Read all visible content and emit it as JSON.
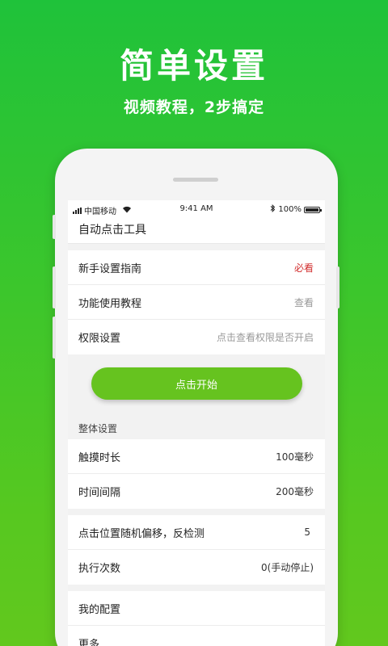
{
  "hero": {
    "title": "简单设置",
    "subtitle": "视频教程，2步搞定"
  },
  "status_bar": {
    "carrier": "中国移动",
    "time": "9:41 AM",
    "battery": "100%",
    "icons": [
      "signal-icon",
      "wifi-icon",
      "bluetooth-icon",
      "battery-icon"
    ]
  },
  "app": {
    "title": "自动点击工具"
  },
  "guide_group": [
    {
      "label": "新手设置指南",
      "value": "必看",
      "value_color": "#d22f2f"
    },
    {
      "label": "功能使用教程",
      "value": "查看"
    },
    {
      "label": "权限设置",
      "value": "点击查看权限是否开启"
    }
  ],
  "start_button": {
    "label": "点击开始"
  },
  "overall_settings": {
    "title": "整体设置",
    "rows": [
      {
        "label": "触摸时长",
        "value": "100毫秒"
      },
      {
        "label": "时间间隔",
        "value": "200毫秒"
      }
    ]
  },
  "offset_group": [
    {
      "label": "点击位置随机偏移，反检测",
      "value": "5"
    },
    {
      "label": "执行次数",
      "value": "0(手动停止)"
    }
  ],
  "more_group": [
    {
      "label": "我的配置"
    },
    {
      "label": "更多"
    }
  ],
  "colors": {
    "brand_green": "#1fc23a",
    "button_green": "#66c31f",
    "accent_red": "#d22f2f"
  }
}
